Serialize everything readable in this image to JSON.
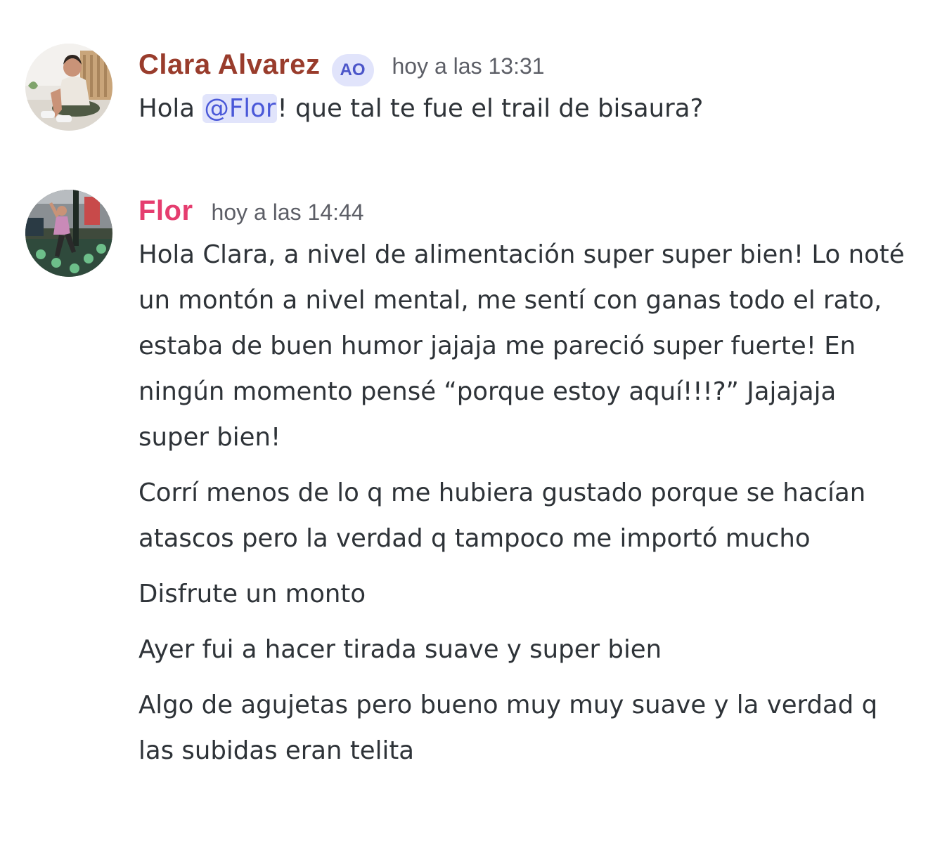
{
  "messages": [
    {
      "author": "Clara Alvarez",
      "tag": "AO",
      "timestamp": "hoy a las 13:31",
      "text_before": "Hola ",
      "mention": "@Flor",
      "text_after": "! que tal te fue el trail de bisaura?"
    },
    {
      "author": "Flor",
      "timestamp": "hoy a las 14:44",
      "paragraphs": [
        "Hola Clara, a nivel de alimentación super super bien! Lo noté un montón a nivel mental, me sentí con ganas todo el rato, estaba de buen humor jajaja me pareció super fuerte! En ningún momento pensé “porque estoy aquí!!!?” Jajajaja super bien!",
        "Corrí menos de lo q me hubiera gustado porque se hacían atascos pero la verdad q tampoco me importó mucho",
        "Disfrute un monto",
        "Ayer fui a hacer tirada suave y super bien",
        "Algo de agujetas pero bueno muy muy suave y la verdad q las subidas eran telita"
      ]
    }
  ],
  "colors": {
    "clara_name": "#993c2c",
    "flor_name": "#e53d6f",
    "mention_bg": "#e1e4fb",
    "mention_text": "#4a58d8",
    "timestamp": "#5c5e66",
    "body_text": "#2e3338"
  },
  "icons": {
    "clara_avatar": "user-photo-avatar",
    "flor_avatar": "runner-photo-avatar"
  }
}
